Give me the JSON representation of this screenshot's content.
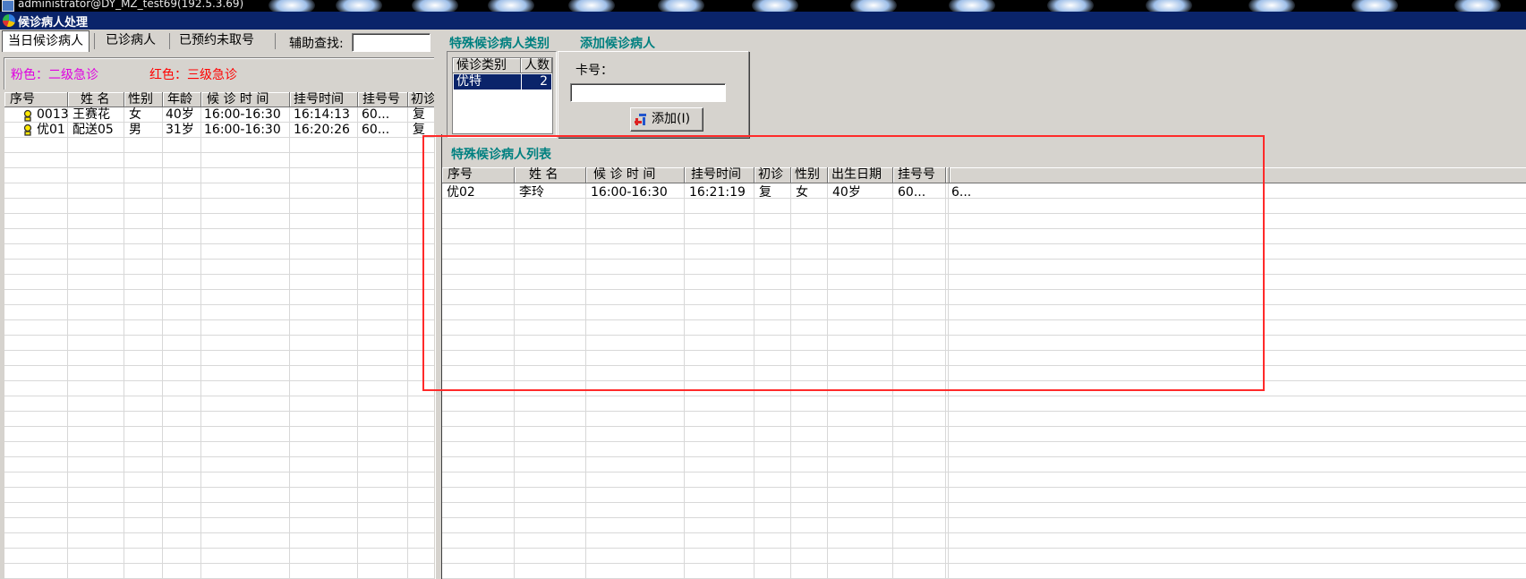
{
  "window": {
    "os_title": "administrator@DY_MZ_test69(192.5.3.69)",
    "title": "候诊病人处理"
  },
  "tabs": [
    "当日候诊病人",
    "已诊病人",
    "已预约未取号"
  ],
  "search": {
    "label": "辅助查找:",
    "value": ""
  },
  "legend": {
    "pink": "粉色：二级急诊",
    "red": "红色：三级急诊",
    "pink_color": "#e000e0",
    "red_color": "#ff0000"
  },
  "left_table": {
    "headers": [
      "序号",
      "姓 名",
      "性别",
      "年龄",
      "候 诊 时 间",
      "挂号时间",
      "挂号号",
      "初诊"
    ],
    "rows": [
      [
        "0013",
        "王赛花",
        "女",
        "40岁",
        "16:00-16:30",
        "16:14:13",
        "60...",
        "复"
      ],
      [
        "优01",
        "配送05",
        "男",
        "31岁",
        "16:00-16:30",
        "16:20:26",
        "60...",
        "复"
      ]
    ]
  },
  "category": {
    "section_title": "特殊候诊病人类别",
    "headers": [
      "候诊类别",
      "人数"
    ],
    "rows": [
      [
        "优特",
        "2"
      ]
    ]
  },
  "add": {
    "section_title": "添加候诊病人",
    "card_label": "卡号：",
    "card_value": "",
    "button_label": "添加(I)"
  },
  "special_list": {
    "section_title": "特殊候诊病人列表",
    "headers": [
      "序号",
      "姓  名",
      "候 诊 时 间",
      "挂号时间",
      "初诊",
      "性别",
      "出生日期",
      "挂号号"
    ],
    "rows": [
      [
        "优02",
        "李玲",
        "16:00-16:30",
        "16:21:19",
        "复",
        "女",
        "40岁",
        "60...",
        "6..."
      ]
    ]
  },
  "colors": {
    "titlebar": "#0a246a",
    "highlight": "#ff2a2a",
    "teal": "#008080",
    "selected": "#0a246a"
  }
}
